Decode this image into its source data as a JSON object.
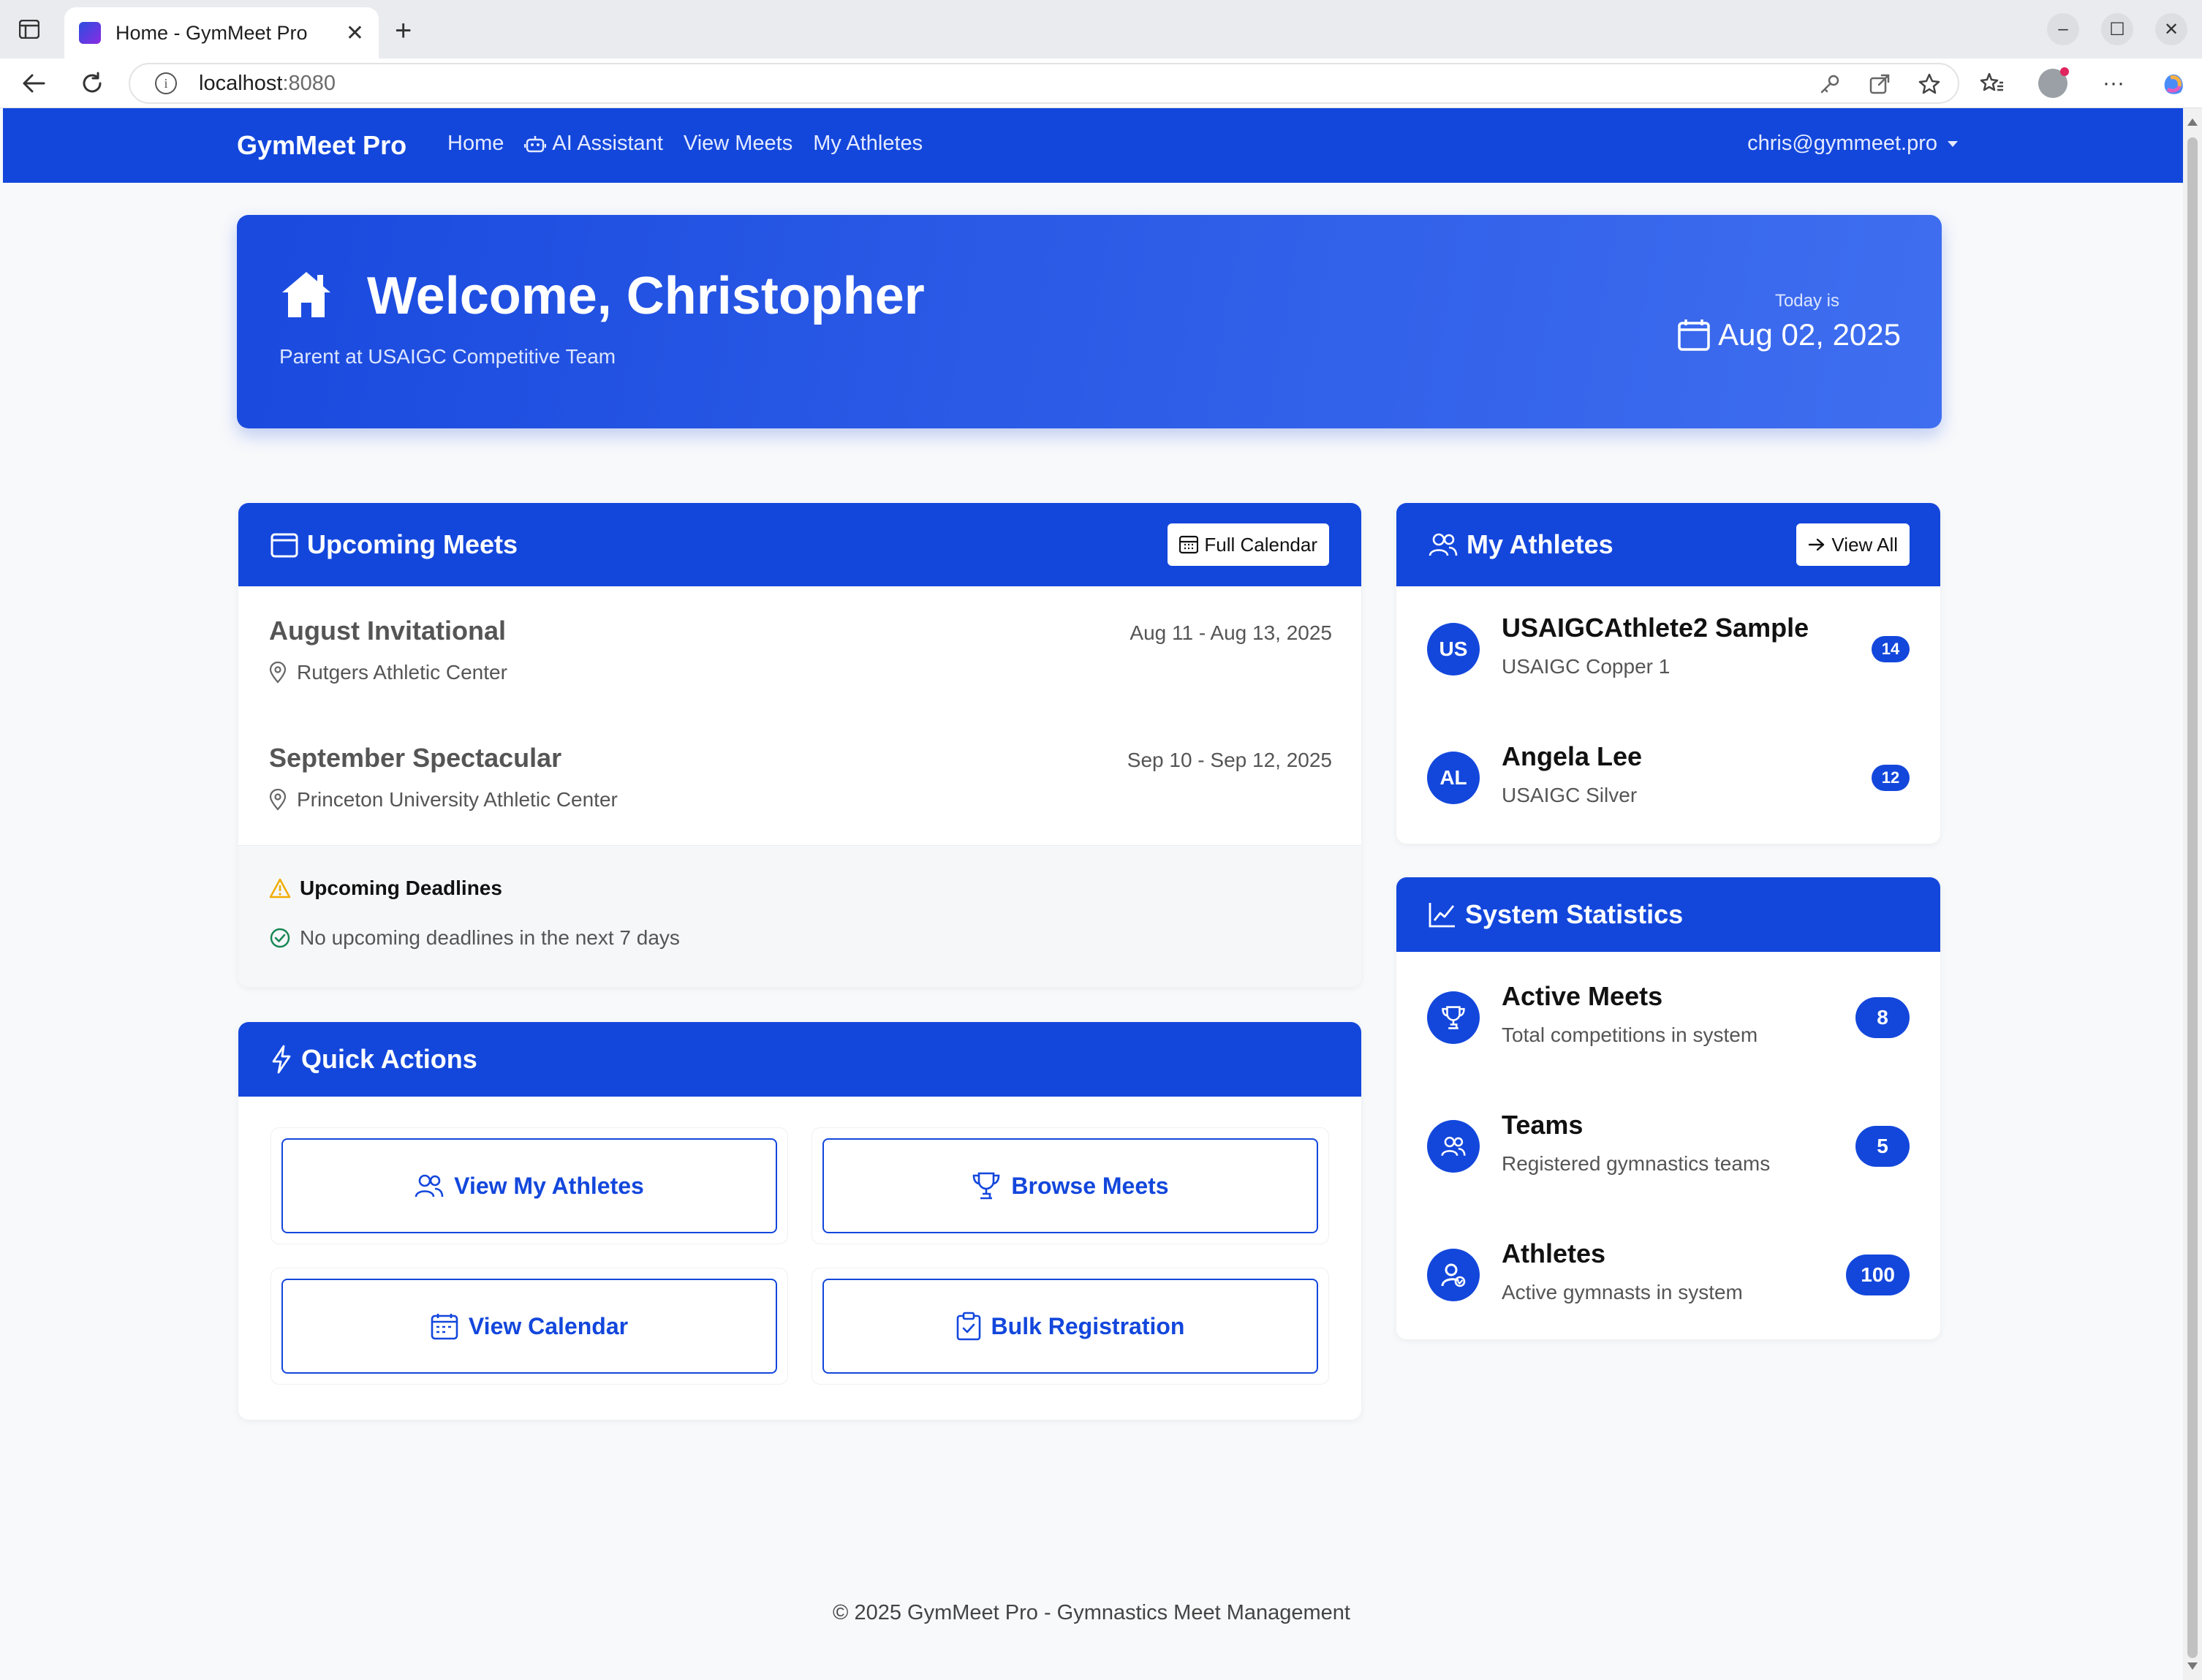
{
  "browser": {
    "tab_title": "Home - GymMeet Pro",
    "url_host": "localhost",
    "url_port": ":8080"
  },
  "nav": {
    "brand": "GymMeet Pro",
    "links": [
      "Home",
      "AI Assistant",
      "View Meets",
      "My Athletes"
    ],
    "user_email": "chris@gymmeet.pro"
  },
  "hero": {
    "title": "Welcome, Christopher",
    "subtitle": "Parent at USAIGC Competitive Team",
    "today_label": "Today is",
    "date": "Aug 02, 2025"
  },
  "upcoming_meets": {
    "title": "Upcoming Meets",
    "button": "Full Calendar",
    "meets": [
      {
        "name": "August Invitational",
        "dates": "Aug 11 - Aug 13, 2025",
        "location": "Rutgers Athletic Center"
      },
      {
        "name": "September Spectacular",
        "dates": "Sep 10 - Sep 12, 2025",
        "location": "Princeton University Athletic Center"
      }
    ],
    "deadlines_title": "Upcoming Deadlines",
    "deadlines_text": "No upcoming deadlines in the next 7 days"
  },
  "quick_actions": {
    "title": "Quick Actions",
    "buttons": [
      "View My Athletes",
      "Browse Meets",
      "View Calendar",
      "Bulk Registration"
    ]
  },
  "my_athletes": {
    "title": "My Athletes",
    "button": "View All",
    "athletes": [
      {
        "initials": "US",
        "name": "USAIGCAthlete2 Sample",
        "level": "USAIGC Copper 1",
        "count": "14"
      },
      {
        "initials": "AL",
        "name": "Angela Lee",
        "level": "USAIGC Silver",
        "count": "12"
      }
    ]
  },
  "system_stats": {
    "title": "System Statistics",
    "items": [
      {
        "name": "Active Meets",
        "desc": "Total competitions in system",
        "value": "8",
        "icon": "trophy-icon"
      },
      {
        "name": "Teams",
        "desc": "Registered gymnastics teams",
        "value": "5",
        "icon": "people-icon"
      },
      {
        "name": "Athletes",
        "desc": "Active gymnasts in system",
        "value": "100",
        "icon": "person-check-icon"
      }
    ]
  },
  "footer": "© 2025 GymMeet Pro - Gymnastics Meet Management",
  "colors": {
    "primary": "#1347dc",
    "background": "#f8f9fb"
  }
}
